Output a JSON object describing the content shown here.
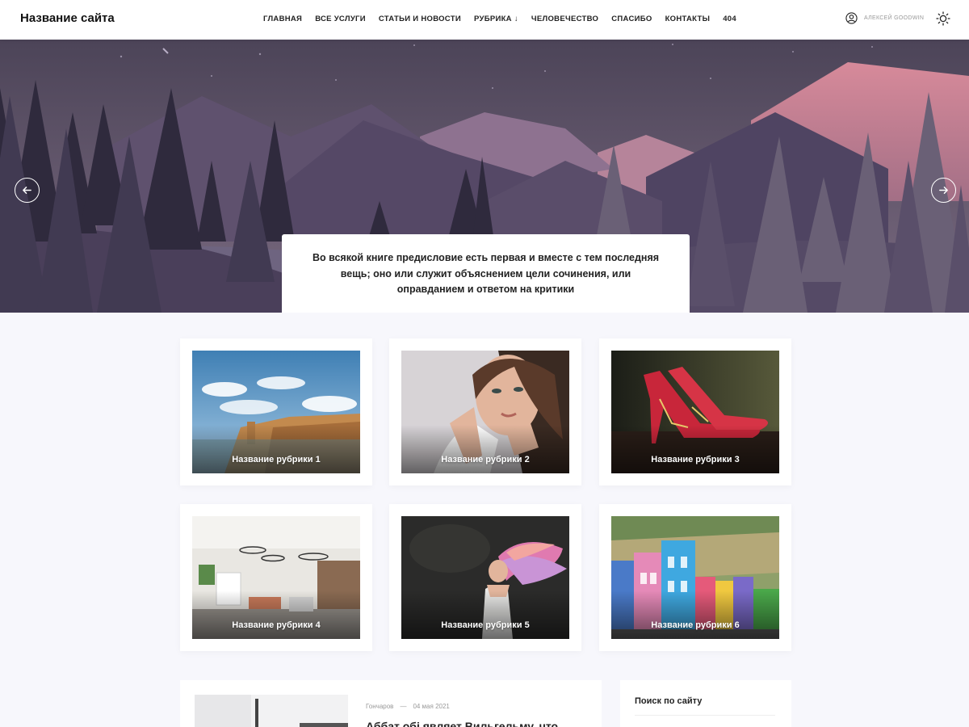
{
  "header": {
    "site_title": "Название сайта",
    "nav": [
      {
        "label": "Главная"
      },
      {
        "label": "Все услуги"
      },
      {
        "label": "Статьи и новости"
      },
      {
        "label": "Рубрика",
        "arrow": "↓"
      },
      {
        "label": "Человечество"
      },
      {
        "label": "Спасибо"
      },
      {
        "label": "Контакты"
      },
      {
        "label": "404"
      }
    ],
    "user_name": "Алексей Goodwin",
    "user_icon": "user-circle-icon",
    "theme_icon": "sun-icon"
  },
  "hero": {
    "quote": "Во всякой книге предисловие есть первая и вместе с тем последняя вещь; оно или служит объяснением цели сочинения, или оправданием и ответом на критики",
    "prev_icon": "arrow-left-icon",
    "next_icon": "arrow-right-icon"
  },
  "categories": [
    {
      "label": "Название рубрики 1"
    },
    {
      "label": "Название рубрики 2"
    },
    {
      "label": "Название рубрики 3"
    },
    {
      "label": "Название рубрики 4"
    },
    {
      "label": "Название рубрики 5"
    },
    {
      "label": "Название рубрики 6"
    }
  ],
  "post": {
    "author": "Гончаров",
    "separator": "—",
    "date": "04 мая 2021",
    "title": "Аббат обі являет Вильгельму, что"
  },
  "sidebar": {
    "search_title": "Поиск по сайту"
  },
  "colors": {
    "accent": "#222222",
    "hero_sky": "#5c5068"
  }
}
